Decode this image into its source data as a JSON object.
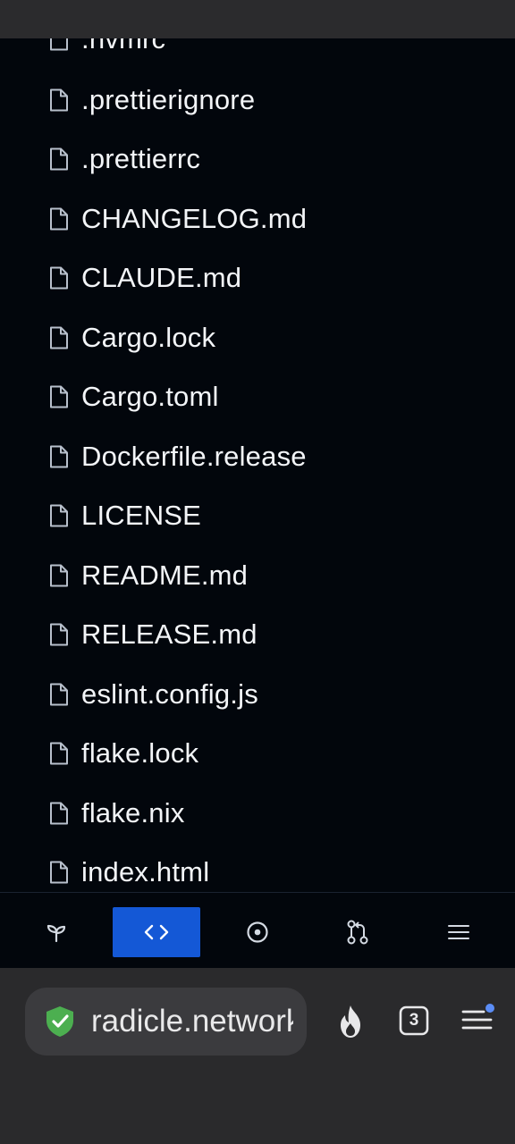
{
  "files": [
    ".nvmrc",
    ".prettierignore",
    ".prettierrc",
    "CHANGELOG.md",
    "CLAUDE.md",
    "Cargo.lock",
    "Cargo.toml",
    "Dockerfile.release",
    "LICENSE",
    "README.md",
    "RELEASE.md",
    "eslint.config.js",
    "flake.lock",
    "flake.nix",
    "index.html"
  ],
  "repo_nav": {
    "items": [
      "seedling-icon",
      "code-icon",
      "target-icon",
      "pull-request-icon",
      "menu-icon"
    ],
    "active_index": 1
  },
  "browser": {
    "url": "radicle.network",
    "tab_count": "3"
  },
  "colors": {
    "background": "#02060c",
    "accent": "#1458d6",
    "shield": "#4caf50",
    "notification_dot": "#5b8df6"
  }
}
